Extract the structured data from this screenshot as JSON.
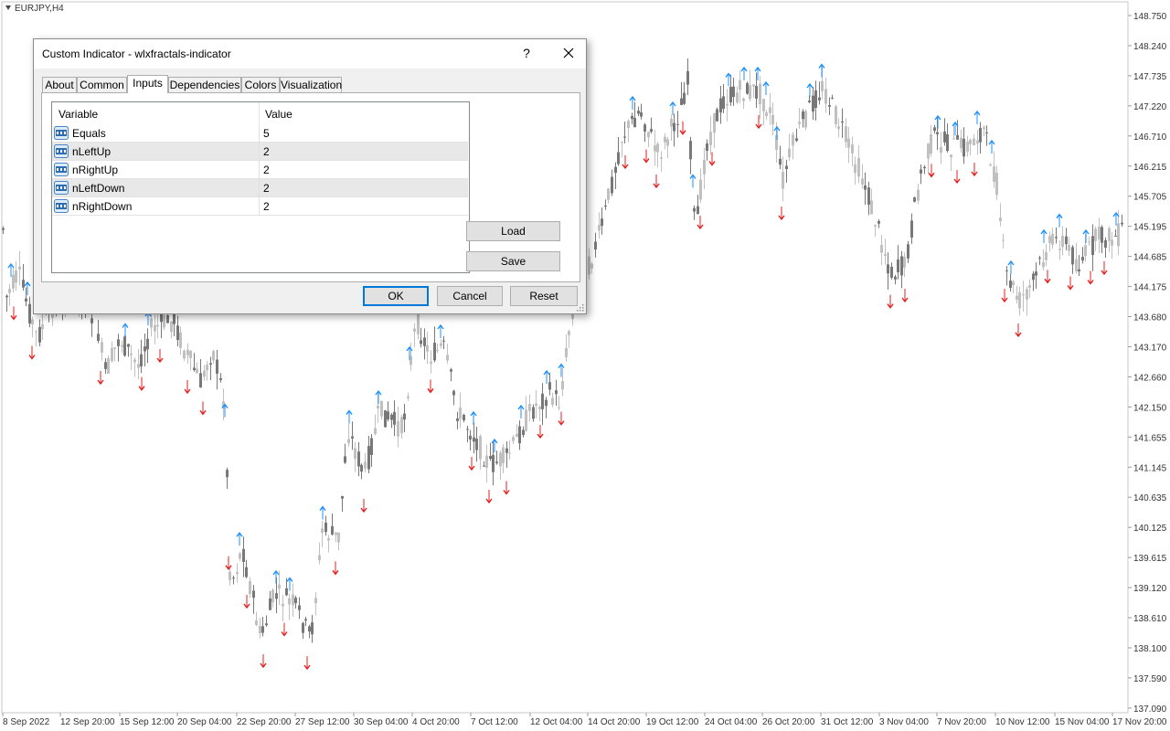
{
  "chart": {
    "symbol": "EURJPY,H4",
    "price_labels": [
      "148.750",
      "148.240",
      "147.735",
      "147.220",
      "146.710",
      "146.215",
      "145.705",
      "145.195",
      "144.685",
      "144.175",
      "143.680",
      "143.170",
      "142.660",
      "142.150",
      "141.655",
      "141.145",
      "140.635",
      "140.125",
      "139.615",
      "139.120",
      "138.610",
      "138.100",
      "137.590",
      "137.090"
    ],
    "time_labels": [
      "8 Sep 2022",
      "12 Sep 20:00",
      "15 Sep 12:00",
      "20 Sep 04:00",
      "22 Sep 20:00",
      "27 Sep 12:00",
      "30 Sep 04:00",
      "4 Oct 20:00",
      "7 Oct 12:00",
      "12 Oct 04:00",
      "14 Oct 20:00",
      "19 Oct 12:00",
      "24 Oct 04:00",
      "26 Oct 20:00",
      "31 Oct 12:00",
      "3 Nov 04:00",
      "7 Nov 20:00",
      "10 Nov 12:00",
      "15 Nov 04:00",
      "17 Nov 20:00"
    ],
    "colors": {
      "bull": "#c0c0c0",
      "bear": "#787878",
      "up_arrow": "#1e90ff",
      "down_arrow": "#e52020",
      "grid_axis": "#c8c8c8"
    }
  },
  "dialog": {
    "title": "Custom Indicator - wlxfractals-indicator",
    "help_label": "?",
    "tabs": [
      "About",
      "Common",
      "Inputs",
      "Dependencies",
      "Colors",
      "Visualization"
    ],
    "active_tab": "Inputs",
    "grid": {
      "headers": {
        "variable": "Variable",
        "value": "Value"
      },
      "rows": [
        {
          "name": "Equals",
          "value": "5"
        },
        {
          "name": "nLeftUp",
          "value": "2"
        },
        {
          "name": "nRightUp",
          "value": "2"
        },
        {
          "name": "nLeftDown",
          "value": "2"
        },
        {
          "name": "nRightDown",
          "value": "2"
        }
      ]
    },
    "buttons": {
      "load": "Load",
      "save": "Save",
      "ok": "OK",
      "cancel": "Cancel",
      "reset": "Reset"
    }
  }
}
